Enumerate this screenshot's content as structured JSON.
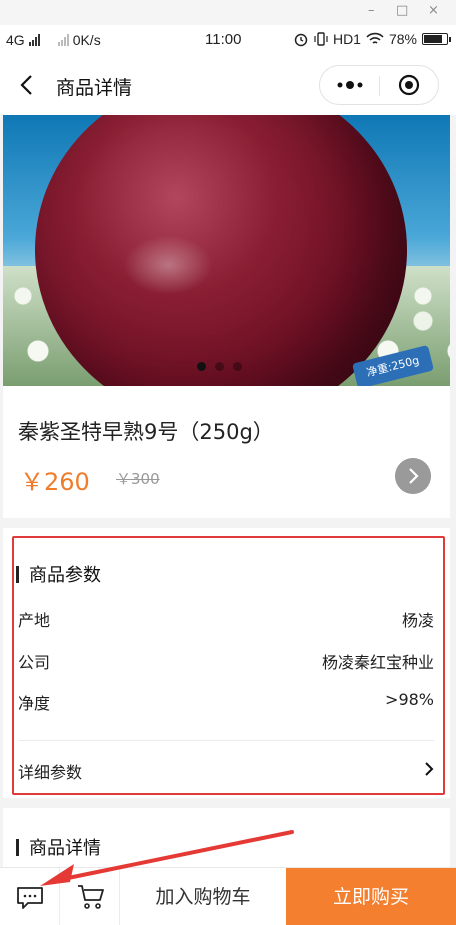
{
  "window": {
    "minimize": "–",
    "maximize": "□",
    "close": "×"
  },
  "status_bar": {
    "network": "4G",
    "speed": "0K/s",
    "time": "11:00",
    "hd": "HD1",
    "battery": "78%",
    "battery_level": 0.78
  },
  "nav": {
    "title": "商品详情",
    "back_icon": "chevron-left-icon",
    "more_icon": "more-dots-icon",
    "close_icon": "target-icon"
  },
  "banner": {
    "badge_text": "净重:250g",
    "slide_count": 3,
    "active_slide": 1
  },
  "product": {
    "name": "秦紫圣特早熟9号（250g）",
    "price": "￥260",
    "original_price": "￥300"
  },
  "params": {
    "title": "商品参数",
    "rows": [
      {
        "label": "产地",
        "value": "杨凌"
      },
      {
        "label": "公司",
        "value": "杨凌秦红宝种业"
      },
      {
        "label": "净度",
        "value": ">98%"
      }
    ],
    "detail_link": "详细参数"
  },
  "details": {
    "title": "商品详情"
  },
  "bottom_bar": {
    "chat_icon": "chat-icon",
    "cart_icon": "cart-icon",
    "add_to_cart": "加入购物车",
    "buy_now": "立即购买"
  },
  "colors": {
    "accent": "#f47f2f",
    "price": "#f07d2c",
    "highlight": "#e03a3a"
  }
}
